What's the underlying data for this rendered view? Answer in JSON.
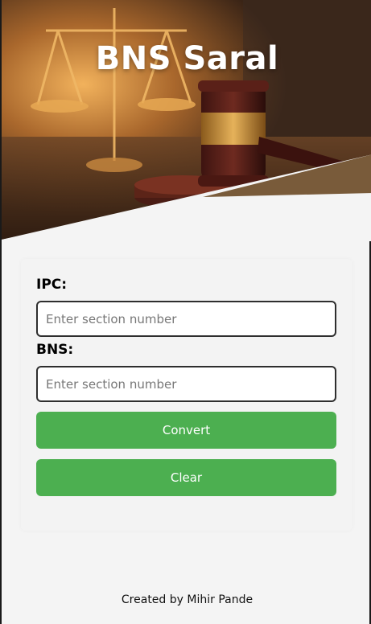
{
  "header": {
    "title": "BNS Saral"
  },
  "form": {
    "ipc_label": "IPC:",
    "ipc_placeholder": "Enter section number",
    "bns_label": "BNS:",
    "bns_placeholder": "Enter section number",
    "convert_label": "Convert",
    "clear_label": "Clear"
  },
  "footer": {
    "credit": "Created by Mihir Pande"
  },
  "colors": {
    "accent": "#4caf50",
    "background": "#f4f4f4",
    "title": "#ffffff"
  }
}
